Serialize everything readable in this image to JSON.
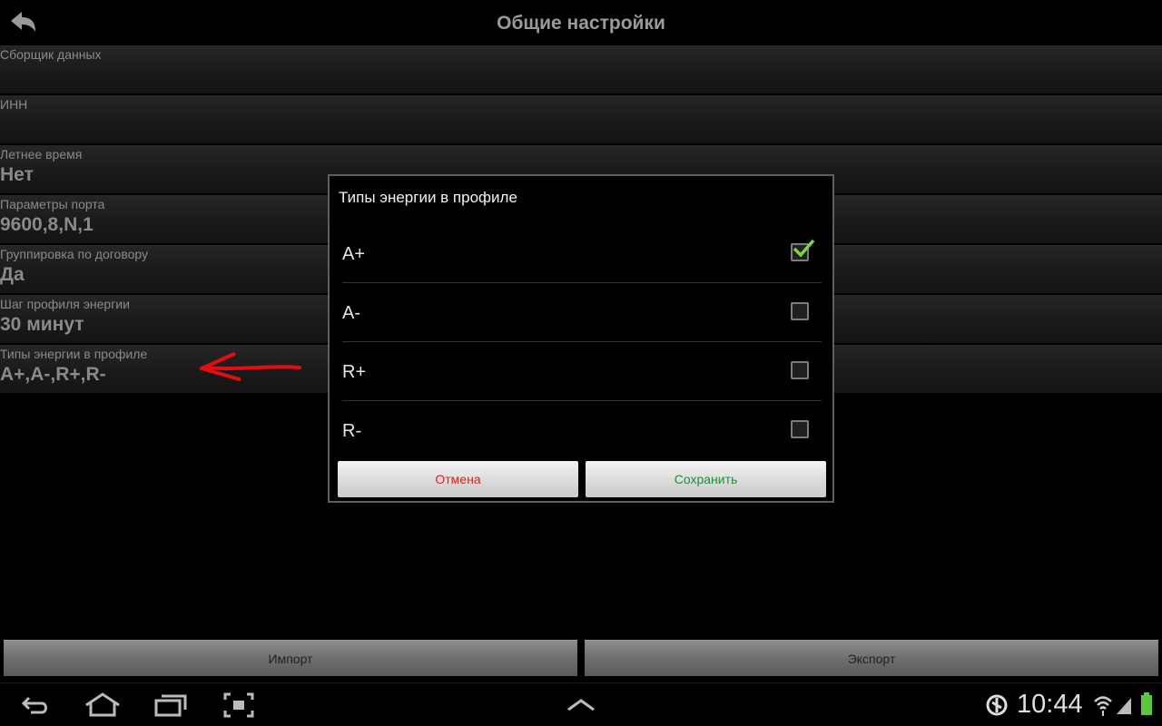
{
  "header": {
    "title": "Общие настройки"
  },
  "settings": [
    {
      "label": "Сборщик данных",
      "value": ""
    },
    {
      "label": "ИНН",
      "value": ""
    },
    {
      "label": "Летнее время",
      "value": "Нет"
    },
    {
      "label": "Параметры порта",
      "value": "9600,8,N,1"
    },
    {
      "label": "Группировка по договору",
      "value": "Да"
    },
    {
      "label": "Шаг профиля энергии",
      "value": "30 минут"
    },
    {
      "label": "Типы энергии в профиле",
      "value": "A+,A-,R+,R-"
    }
  ],
  "bottom": {
    "import_label": "Импорт",
    "export_label": "Экспорт"
  },
  "dialog": {
    "title": "Типы энергии в профиле",
    "options": [
      {
        "label": "A+",
        "checked": true
      },
      {
        "label": "A-",
        "checked": false
      },
      {
        "label": "R+",
        "checked": false
      },
      {
        "label": "R-",
        "checked": false
      }
    ],
    "cancel_label": "Отмена",
    "save_label": "Сохранить",
    "cancel_color": "#e02020",
    "save_color": "#1e8e3e",
    "check_color": "#7dd63a"
  },
  "status": {
    "time": "10:44"
  },
  "annotation": {
    "arrow_color": "#e01010"
  }
}
